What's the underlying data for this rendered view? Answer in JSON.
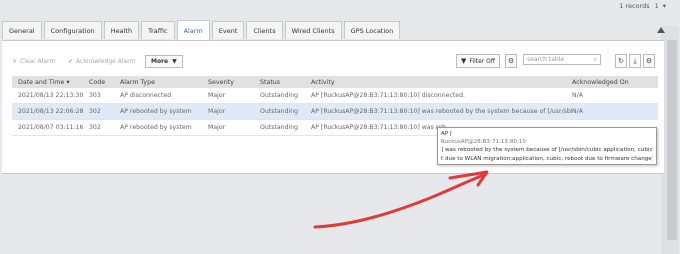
{
  "pager": {
    "records_text": "1 records",
    "page": "1"
  },
  "tabs": [
    {
      "label": "General"
    },
    {
      "label": "Configuration"
    },
    {
      "label": "Health"
    },
    {
      "label": "Traffic"
    },
    {
      "label": "Alarm"
    },
    {
      "label": "Event"
    },
    {
      "label": "Clients"
    },
    {
      "label": "Wired Clients"
    },
    {
      "label": "GPS Location"
    }
  ],
  "active_tab": "Alarm",
  "toolbar": {
    "clear_alarm": "Clear Alarm",
    "acknowledge_alarm": "Acknowledge Alarm",
    "more": "More",
    "filter": "Filter Off",
    "search_placeholder": "search table"
  },
  "table": {
    "columns": [
      "Date and Time",
      "Code",
      "Alarm Type",
      "Severity",
      "Status",
      "Activity",
      "Acknowledged On"
    ],
    "rows": [
      {
        "date": "2021/08/13 22:13:30",
        "code": "303",
        "type": "AP disconnected",
        "severity": "Major",
        "status": "Outstanding",
        "activity": "AP [RuckusAP@28:B3:71:13:80:10] disconnected.",
        "ack": "N/A"
      },
      {
        "date": "2021/08/13 22:06:28",
        "code": "302",
        "type": "AP rebooted by system",
        "severity": "Major",
        "status": "Outstanding",
        "activity": "AP [RuckusAP@28:B3:71:13:80:10] was rebooted by the system because of [/usr/sbin/c...",
        "ack": "N/A"
      },
      {
        "date": "2021/08/07 03:11:16",
        "code": "302",
        "type": "AP rebooted by system",
        "severity": "Major",
        "status": "Outstanding",
        "activity": "AP [RuckusAP@28:B3:71:13:80:10] was reb",
        "ack": ""
      }
    ]
  },
  "tooltip": {
    "line1": "AP [",
    "line2": "RuckusAP@28:B3:71:13:80:10",
    "line3": "] was rebooted by the system because of [/usr/sbin/cubic application, cubic, rebo",
    "line4": "t due to WLAN migration;application, cubic, reboot due to firmware change]."
  },
  "colors": {
    "accent": "#2a6fb5",
    "annotation": "#e03a3a",
    "selected_row": "#dfeaf7"
  }
}
